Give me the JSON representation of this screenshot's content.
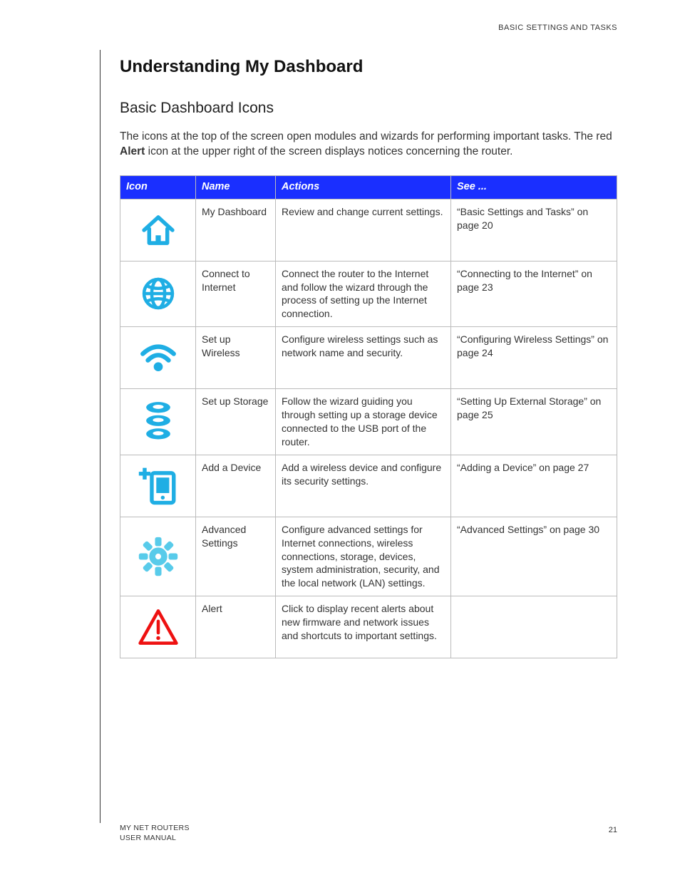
{
  "header_label": "BASIC SETTINGS AND TASKS",
  "page_title": "Understanding My Dashboard",
  "section_title": "Basic Dashboard Icons",
  "intro_pre": "The icons at the top of the screen open modules and wizards for performing important tasks. The red ",
  "intro_bold": "Alert",
  "intro_post": " icon at the upper right of the screen displays notices concerning the router.",
  "columns": {
    "icon": "Icon",
    "name": "Name",
    "actions": "Actions",
    "see": "See ..."
  },
  "rows": [
    {
      "name": "My Dashboard",
      "actions": "Review and change current settings.",
      "see": "“Basic Settings and Tasks” on page 20"
    },
    {
      "name": "Connect to Internet",
      "actions": "Connect the router to the Internet and follow the wizard through the process of setting up the Internet connection.",
      "see": "“Connecting to the Internet” on page 23"
    },
    {
      "name": "Set up Wireless",
      "actions": "Configure wireless settings such as network name and security.",
      "see": "“Configuring Wireless Settings” on page 24"
    },
    {
      "name": "Set up Storage",
      "actions": "Follow the wizard guiding you through setting up a storage device connected to the USB port of the router.",
      "see": "“Setting Up External Storage” on page 25"
    },
    {
      "name": "Add a Device",
      "actions": "Add a wireless device and configure its security settings.",
      "see": "“Adding a Device” on page 27"
    },
    {
      "name": "Advanced Settings",
      "actions": "Configure advanced settings for Internet connections, wireless connections, storage, devices, system administration, security, and the local network (LAN) settings.",
      "see": "“Advanced Settings” on page 30"
    },
    {
      "name": "Alert",
      "actions": "Click to display recent alerts about new firmware and network issues and shortcuts to important settings.",
      "see": ""
    }
  ],
  "footer_line1": "MY NET ROUTERS",
  "footer_line2": "USER MANUAL",
  "page_number": "21"
}
